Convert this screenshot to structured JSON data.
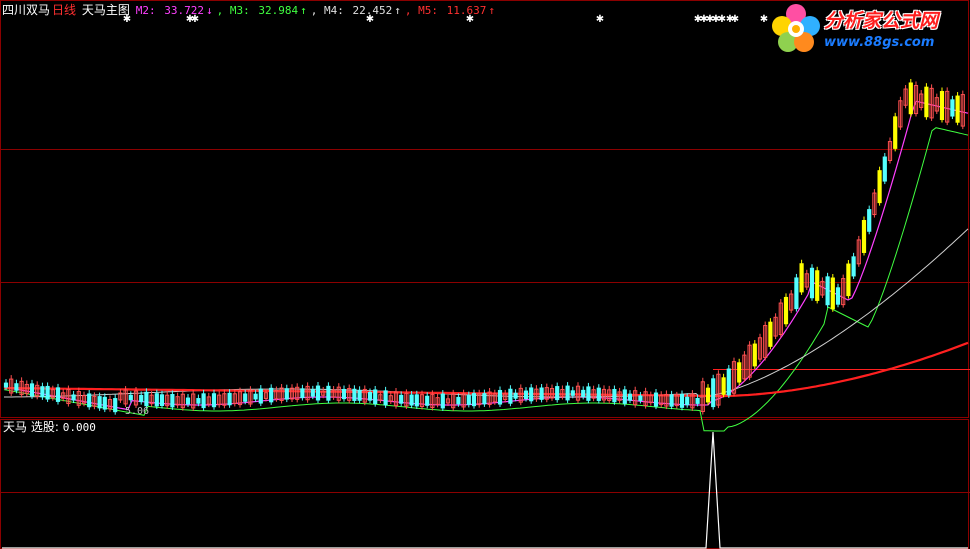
{
  "header": {
    "indicator_name": "四川双马",
    "period": "日线",
    "formula_name": "天马主图",
    "m2_label": "M2:",
    "m2_value": "33.722",
    "m2_arrow": "↓",
    "m3_label": ", M3:",
    "m3_value": "32.984",
    "m3_arrow": "↑",
    "m4_label": ", M4:",
    "m4_value": "22.452",
    "m4_arrow": "↑",
    "m5_label": ", M5:",
    "m5_value": "11.637",
    "m5_arrow": "↑"
  },
  "sub_panel": {
    "title": "天马",
    "select_label": "选股:",
    "select_value": "0.000"
  },
  "price_label": "5.06",
  "logo": {
    "name": "分析家公式网",
    "url": "www.88gs.com",
    "icon": "flower-logo-icon"
  },
  "colors": {
    "background": "#000000",
    "grid": "#8b0000",
    "up_candle": "#ff5050",
    "down_candle": "#54ffff",
    "yellow_bar": "#ffff00",
    "ma_purple": "#ff40ff",
    "ma_green": "#40ff40",
    "ma_white": "#d0d0d0",
    "ma_red": "#ff2020"
  },
  "chart_data": {
    "type": "candlestick",
    "series": [
      {
        "name": "M2",
        "last": 33.722
      },
      {
        "name": "M3",
        "last": 32.984
      },
      {
        "name": "M4",
        "last": 22.452
      },
      {
        "name": "M5",
        "last": 11.637
      }
    ],
    "annotations": [
      "5.06"
    ],
    "sub_series": {
      "name": "选股",
      "last": 0.0,
      "spike_index": 0.73
    }
  }
}
